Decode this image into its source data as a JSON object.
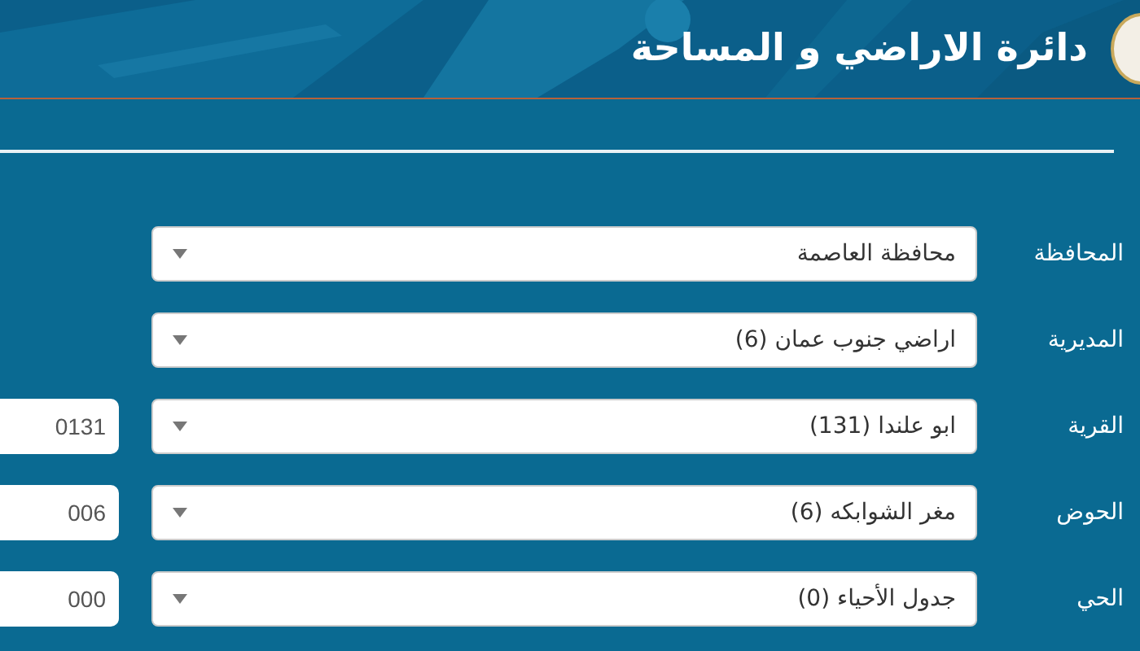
{
  "header": {
    "title": "دائرة الاراضي و المساحة"
  },
  "fields": [
    {
      "label": "المحافظة",
      "value": "محافظة العاصمة"
    },
    {
      "label": "المديرية",
      "value": "اراضي جنوب عمان (6)"
    },
    {
      "label": "القرية",
      "value": "ابو علندا (131)",
      "code": "0131"
    },
    {
      "label": "الحوض",
      "value": "مغر الشوابكه (6)",
      "code": "006"
    },
    {
      "label": "الحي",
      "value": "جدول الأحياء (0)",
      "code": "000"
    }
  ]
}
